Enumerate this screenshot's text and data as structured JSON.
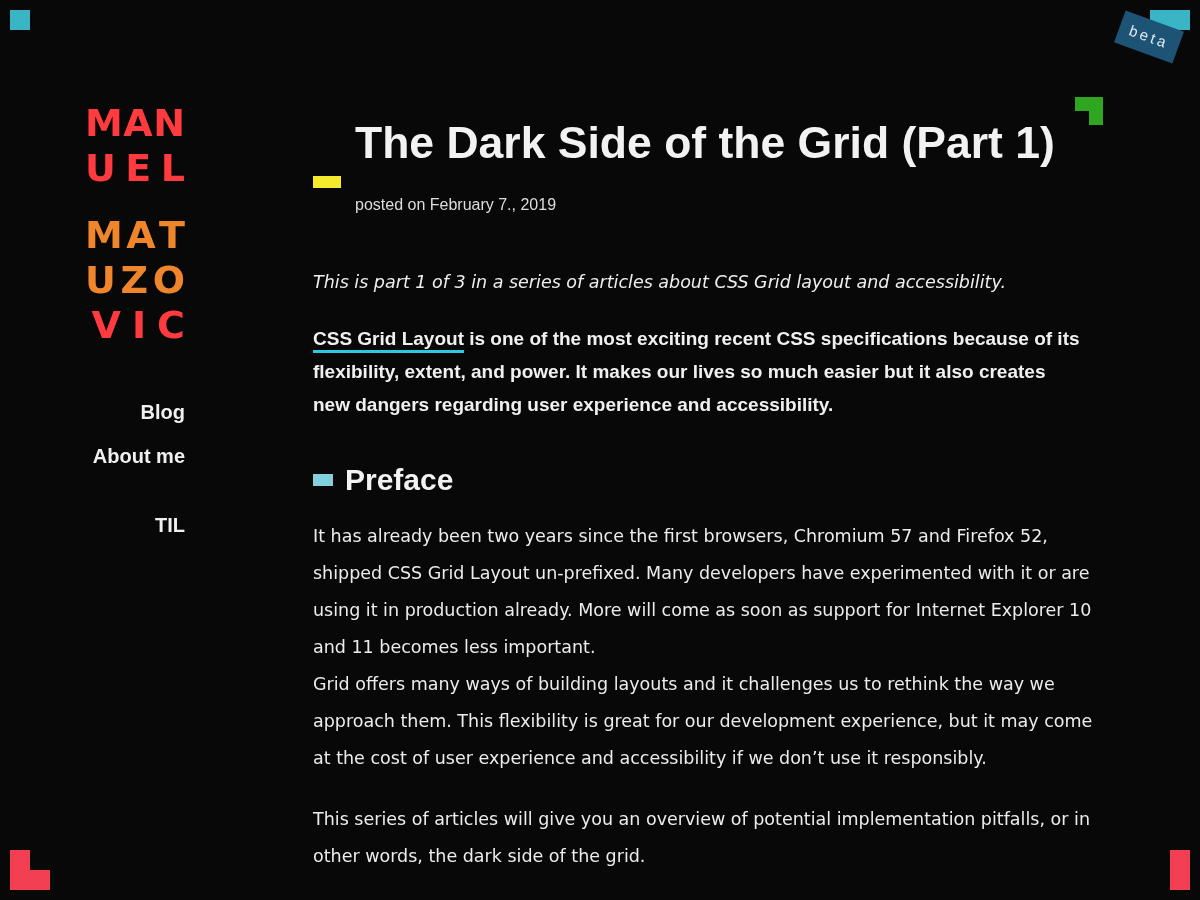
{
  "badge": "beta",
  "logo": {
    "groups": [
      {
        "lines": [
          {
            "text": "MAN",
            "color": "#ff3b3f"
          },
          {
            "text": "UEL",
            "color": "#ff3b3f"
          }
        ]
      },
      {
        "lines": [
          {
            "text": "MAT",
            "color": "#f0862c"
          },
          {
            "text": "UZO",
            "color": "#f0862c"
          },
          {
            "text": "VIC",
            "color": "#ff3b3f"
          }
        ]
      }
    ]
  },
  "nav": [
    {
      "label": "Blog"
    },
    {
      "label": "About me"
    },
    {
      "label": "TIL"
    }
  ],
  "article": {
    "title": "The Dark Side of the Grid (Part 1)",
    "date": "posted on February 7., 2019",
    "intro": "This is part 1 of 3 in a series of articles about CSS Grid layout and accessibility.",
    "lead": {
      "link": "CSS Grid Layout",
      "text": " is one of the most exciting recent CSS specifications because of its flexibility, extent, and power. It makes our lives so much easier but it also creates new dangers regarding user experience and accessibility."
    },
    "sections": [
      {
        "heading": "Preface",
        "paragraphs": [
          {
            "lines": [
              "It has already been two years since the first browsers, Chromium 57 and Firefox 52, shipped CSS Grid Layout un-prefixed. Many developers have experimented with it or are using it in production already. More will come as soon as support for Internet Explorer 10 and 11 becomes less important.",
              "Grid offers many ways of building layouts and it challenges us to rethink the way we approach them. This flexibility is great for our development experience, but it may come at the cost of user experience and accessibility if we don’t use it responsibly."
            ]
          },
          {
            "lines": [
              "This series of articles will give you an overview of potential implementation pitfalls, or in other words, the dark side of the grid."
            ]
          }
        ]
      }
    ]
  }
}
